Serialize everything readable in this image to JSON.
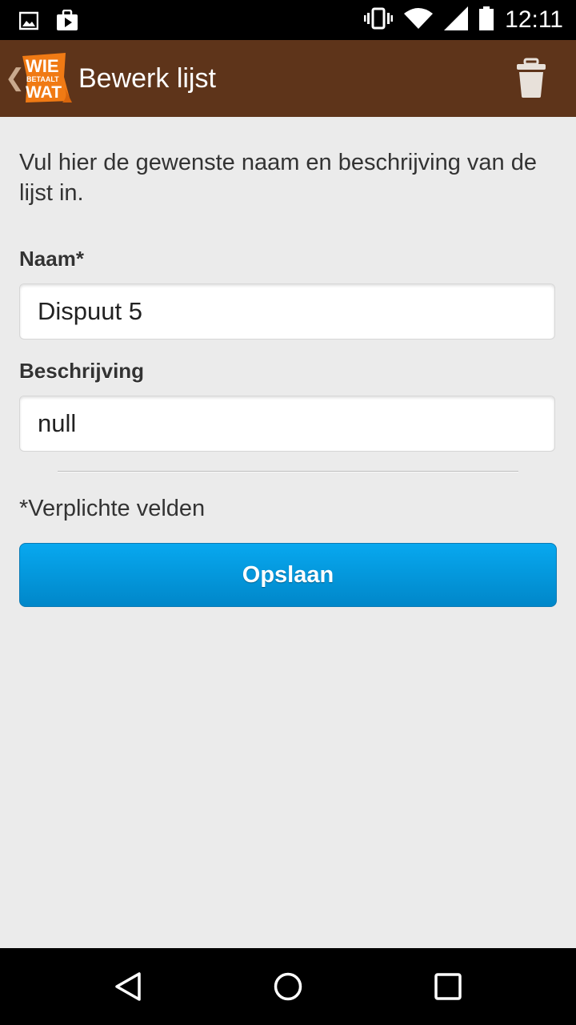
{
  "status_bar": {
    "time": "12:11",
    "icons": [
      "gallery-icon",
      "play-store-icon",
      "vibrate-icon",
      "wifi-icon",
      "signal-icon",
      "battery-icon"
    ]
  },
  "action_bar": {
    "logo_text": [
      "WIE",
      "BETAALT",
      "WAT"
    ],
    "title": "Bewerk lijst",
    "background": "#5e341a"
  },
  "form": {
    "intro": "Vul hier de gewenste naam en beschrijving van de lijst in.",
    "name_label": "Naam*",
    "name_value": "Dispuut 5",
    "description_label": "Beschrijving",
    "description_value": "null",
    "required_note": "*Verplichte velden",
    "save_label": "Opslaan",
    "accent": "#0a9be0"
  },
  "nav_bar": {
    "buttons": [
      "back-icon",
      "home-icon",
      "recents-icon"
    ]
  }
}
